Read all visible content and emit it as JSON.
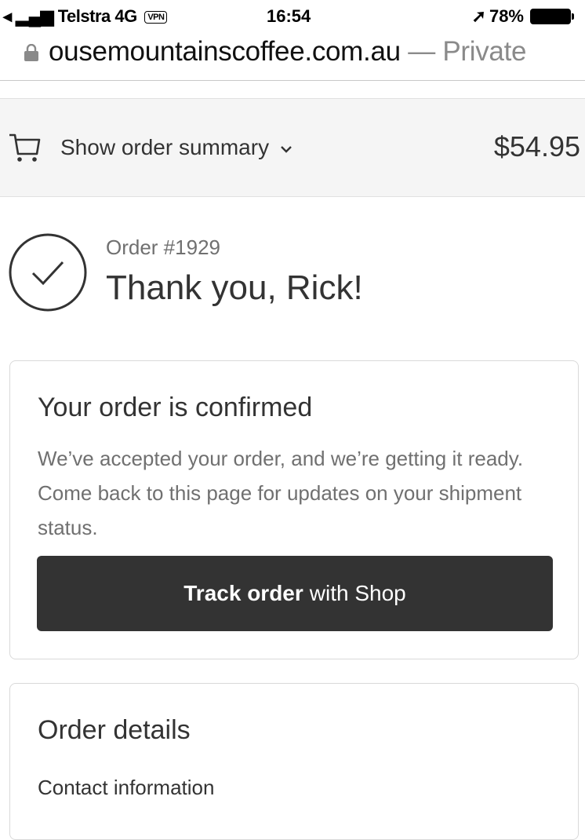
{
  "status_bar": {
    "carrier": "Telstra 4G",
    "vpn": "VPN",
    "time": "16:54",
    "battery": "78%"
  },
  "browser": {
    "url": "ousemountainscoffee.com.au",
    "private_label": "— Private"
  },
  "summary": {
    "label": "Show order summary",
    "total": "$54.95"
  },
  "order": {
    "number": "Order #1929",
    "greeting": "Thank you, Rick!"
  },
  "confirmation": {
    "title": "Your order is confirmed",
    "body": "We’ve accepted your order, and we’re getting it ready. Come back to this page for updates on your shipment status.",
    "button_bold": "Track order",
    "button_rest": "with Shop"
  },
  "details": {
    "title": "Order details",
    "contact_heading": "Contact information"
  }
}
